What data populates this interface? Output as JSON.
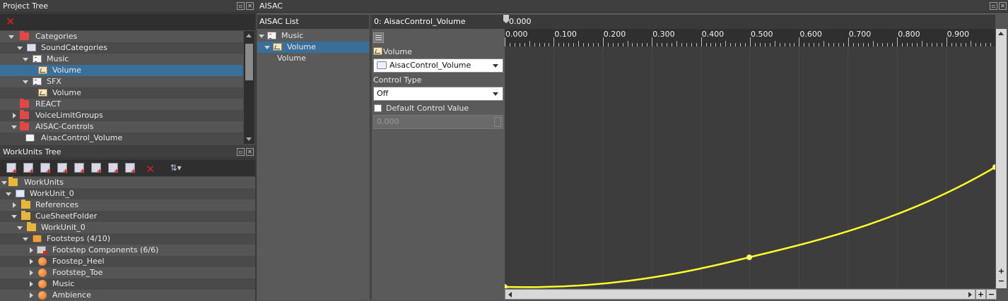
{
  "project_tree": {
    "title": "Project Tree",
    "items": [
      {
        "label": "Categories"
      },
      {
        "label": "SoundCategories"
      },
      {
        "label": "Music"
      },
      {
        "label": "Volume"
      },
      {
        "label": "SFX"
      },
      {
        "label": "Volume"
      },
      {
        "label": "REACT"
      },
      {
        "label": "VoiceLimitGroups"
      },
      {
        "label": "AISAC-Controls"
      },
      {
        "label": "AisacControl_Volume"
      }
    ]
  },
  "workunits_tree": {
    "title": "WorkUnits Tree",
    "items": [
      {
        "label": "WorkUnits"
      },
      {
        "label": "WorkUnit_0"
      },
      {
        "label": "References"
      },
      {
        "label": "CueSheetFolder"
      },
      {
        "label": "WorkUnit_0"
      },
      {
        "label": "Footsteps (4/10)"
      },
      {
        "label": "Footstep Components (6/6)"
      },
      {
        "label": "Foostep_Heel"
      },
      {
        "label": "Footstep_Toe"
      },
      {
        "label": "Music"
      },
      {
        "label": "Ambience"
      }
    ]
  },
  "aisac": {
    "title": "AISAC",
    "list_header": "AISAC List",
    "list": [
      {
        "label": "Music"
      },
      {
        "label": "Volume"
      },
      {
        "label": "Volume"
      }
    ],
    "graph_header": "0: AisacControl_Volume",
    "cursor_value": "0.000",
    "property_label": "Volume",
    "control_value": "AisacControl_Volume",
    "control_type_label": "Control Type",
    "control_type_value": "Off",
    "default_control_label": "Default Control Value",
    "default_control_value": "0.000",
    "ruler_ticks": [
      "0.000",
      "0.100",
      "0.200",
      "0.300",
      "0.400",
      "0.500",
      "0.600",
      "0.700",
      "0.800",
      "0.900"
    ],
    "zoom_in_label": "+",
    "zoom_out_label": "−"
  },
  "colors": {
    "curve": "#ffff2a",
    "selection": "#3a6f9a",
    "delete_red": "#e02020"
  }
}
